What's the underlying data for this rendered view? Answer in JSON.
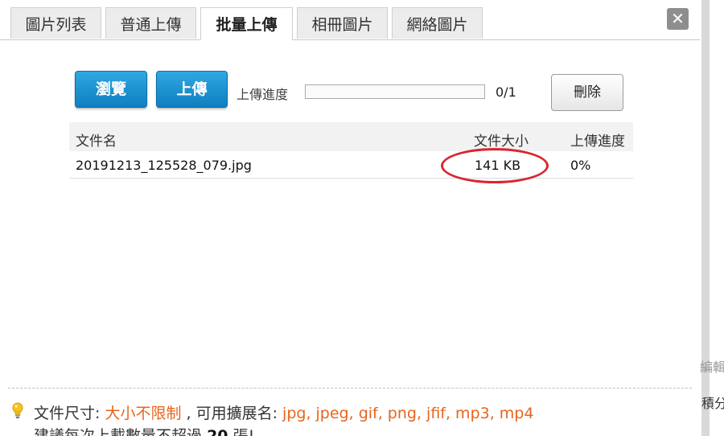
{
  "tabs": [
    {
      "label": "圖片列表"
    },
    {
      "label": "普通上傳"
    },
    {
      "label": "批量上傳"
    },
    {
      "label": "相冊圖片"
    },
    {
      "label": "網絡圖片"
    }
  ],
  "active_tab": "批量上傳",
  "close_symbol": "✕",
  "toolbar": {
    "browse_label": "瀏覽",
    "upload_label": "上傳",
    "progress_label": "上傳進度",
    "progress_fraction": 0,
    "progress_count": "0/1",
    "delete_label": "刪除"
  },
  "table": {
    "headers": {
      "name": "文件名",
      "size": "文件大小",
      "progress": "上傳進度"
    },
    "rows": [
      {
        "name": "20191213_125528_079.jpg",
        "size": "141 KB",
        "progress": "0%"
      }
    ]
  },
  "annotation": {
    "color": "#d9262e"
  },
  "footer": {
    "size_label": "文件尺寸:",
    "size_value": "大小不限制",
    "ext_label": ", 可用擴展名:",
    "ext_value": "jpg, jpeg, gif, png, jfif, mp3, mp4",
    "tip_prefix": "建議每次上載數量不超過",
    "tip_count": "20",
    "tip_suffix": "張!"
  },
  "edge": {
    "text1": "編輯",
    "text2": "積分"
  },
  "colors": {
    "accent": "#e8641c",
    "button_blue": "#1a8fd0"
  },
  "icons": {
    "close": "close-icon",
    "bulb": "lightbulb-icon"
  }
}
